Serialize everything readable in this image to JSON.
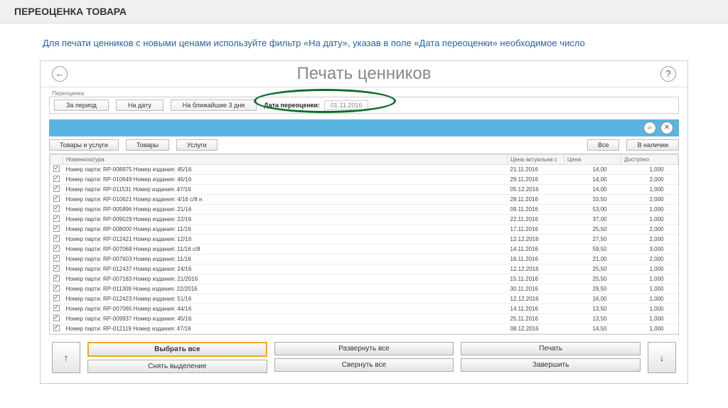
{
  "header": {
    "title": "ПЕРЕОЦЕНКА ТОВАРА"
  },
  "instruction": "Для печати ценников с новыми ценами используйте фильтр «На дату», указав в поле «Дата переоценки» необходимое число",
  "app": {
    "title": "Печать ценников",
    "filter": {
      "fieldset_label": "Переоценка",
      "tab_period": "За период",
      "tab_date": "На дату",
      "tab_next3": "На ближайшие 3 дня",
      "date_label": "Дата переоценки:",
      "date_value": "01.11.2016"
    },
    "type_tabs": {
      "all_types": "Товары и услуги",
      "goods": "Товары",
      "services": "Услуги",
      "all": "Все",
      "in_stock": "В наличии"
    },
    "table": {
      "col_name": "Номенклатура",
      "col_date": "Цена актуальна с",
      "col_price": "Цена",
      "col_avail": "Доступно",
      "rows": [
        {
          "n": "Номер парти: RP-008975 Номер издания: 45/16",
          "d": "21.11.2016",
          "p": "14,00",
          "a": "1,000"
        },
        {
          "n": "Номер парти: RP-010649 Номер издания: 46/16",
          "d": "29.11.2016",
          "p": "14,00",
          "a": "2,000"
        },
        {
          "n": "Номер парти: RP-011531 Номер издания: 47/16",
          "d": "05.12.2016",
          "p": "14,00",
          "a": "1,000"
        },
        {
          "n": "Номер парти: RP-010621 Номер издания: 4/16 с/8 н",
          "d": "28.11.2016",
          "p": "33,50",
          "a": "2,000"
        },
        {
          "n": "Номер парти: RP-005896 Номер издания: 21/16",
          "d": "09.11.2016",
          "p": "53,00",
          "a": "1,000"
        },
        {
          "n": "Номер парти: RP-009029 Номер издания: 22/16",
          "d": "22.11.2016",
          "p": "37,00",
          "a": "1,000"
        },
        {
          "n": "Номер парти: RP-008000 Номер издания: 11/16",
          "d": "17.11.2016",
          "p": "25,50",
          "a": "2,000"
        },
        {
          "n": "Номер парти: RP-012421 Номер издания: 12/16",
          "d": "12.12.2016",
          "p": "27,50",
          "a": "2,000"
        },
        {
          "n": "Номер парти: RP-007068 Номер издания: 11/16 с/8",
          "d": "14.11.2016",
          "p": "59,50",
          "a": "3,000"
        },
        {
          "n": "Номер парти: RP-007603 Номер издания: 11/16",
          "d": "16.11.2016",
          "p": "21,00",
          "a": "2,000"
        },
        {
          "n": "Номер парти: RP-012437 Номер издания: 24/16",
          "d": "12.12.2016",
          "p": "25,50",
          "a": "1,000"
        },
        {
          "n": "Номер парти: RP-007183 Номер издания: 21/2016",
          "d": "15.11.2016",
          "p": "25,50",
          "a": "1,000"
        },
        {
          "n": "Номер парти: RP-011309 Номер издания: 22/2016",
          "d": "30.11.2016",
          "p": "29,50",
          "a": "1,000"
        },
        {
          "n": "Номер парти: RP-012423 Номер издания: 51/16",
          "d": "12.12.2016",
          "p": "16,00",
          "a": "1,000"
        },
        {
          "n": "Номер парти: RP-007065 Номер издания: 44/16",
          "d": "14.11.2016",
          "p": "13,50",
          "a": "1,000"
        },
        {
          "n": "Номер парти: RP-009937 Номер издания: 45/16",
          "d": "25.11.2016",
          "p": "13,50",
          "a": "1,000"
        },
        {
          "n": "Номер парти: RP-012119 Номер издания: 47/16",
          "d": "08.12.2016",
          "p": "14,50",
          "a": "1,000"
        }
      ]
    },
    "footer": {
      "select_all": "Выбрать все",
      "deselect": "Снять выделение",
      "expand_all": "Развернуть все",
      "collapse_all": "Свернуть все",
      "print": "Печать",
      "finish": "Завершить"
    }
  }
}
